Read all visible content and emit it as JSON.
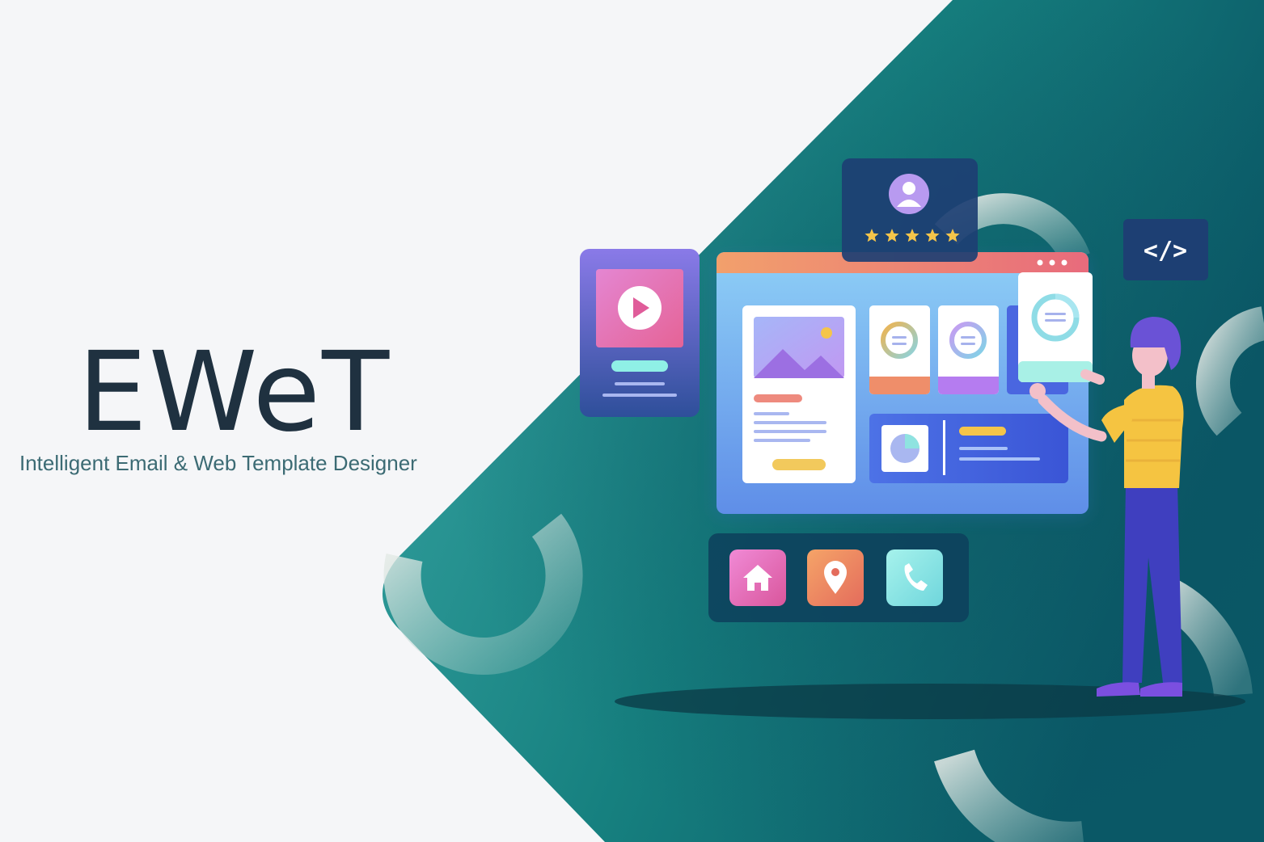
{
  "brand": {
    "title": "EWeT",
    "subtitle": "Intelligent Email & Web Template Designer"
  },
  "illustration": {
    "code_badge": "</>",
    "rating_stars": 5,
    "icons": [
      "play-icon",
      "user-icon",
      "star-icon",
      "code-icon",
      "image-icon",
      "pie-chart-icon",
      "home-icon",
      "location-pin-icon",
      "phone-icon"
    ],
    "colors": {
      "background": "#f5f6f8",
      "teal_panel": "#1d8a8a",
      "teal_dark": "#0c5f6a",
      "title": "#1f3140",
      "subtitle": "#3c6b74",
      "window_header": "#f09a78",
      "card_pink": "#e05c9a",
      "card_orange": "#f08a5d",
      "card_cyan": "#7ee6e0",
      "star": "#f5c54a",
      "shirt": "#f5c441",
      "pants": "#3f3fbf"
    }
  }
}
